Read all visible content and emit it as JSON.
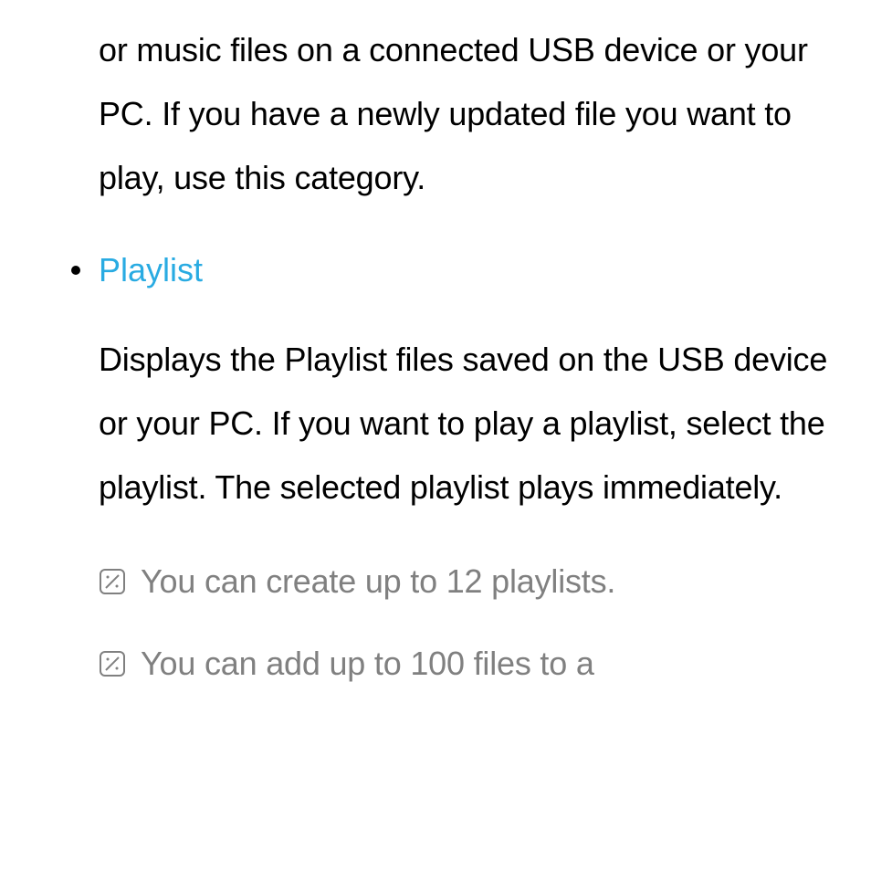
{
  "content": {
    "intro_paragraph": "or music files on a connected USB device or your PC. If you have a newly updated file you want to play, use this category.",
    "bullet_title": "Playlist",
    "playlist_description": "Displays the Playlist files saved on the USB device or your PC. If you want to play a playlist, select the playlist. The selected playlist plays immediately.",
    "note1": "You can create up to 12 playlists.",
    "note2": "You can add up to 100 files to a"
  },
  "colors": {
    "accent": "#29abe2",
    "note_gray": "#808080"
  }
}
